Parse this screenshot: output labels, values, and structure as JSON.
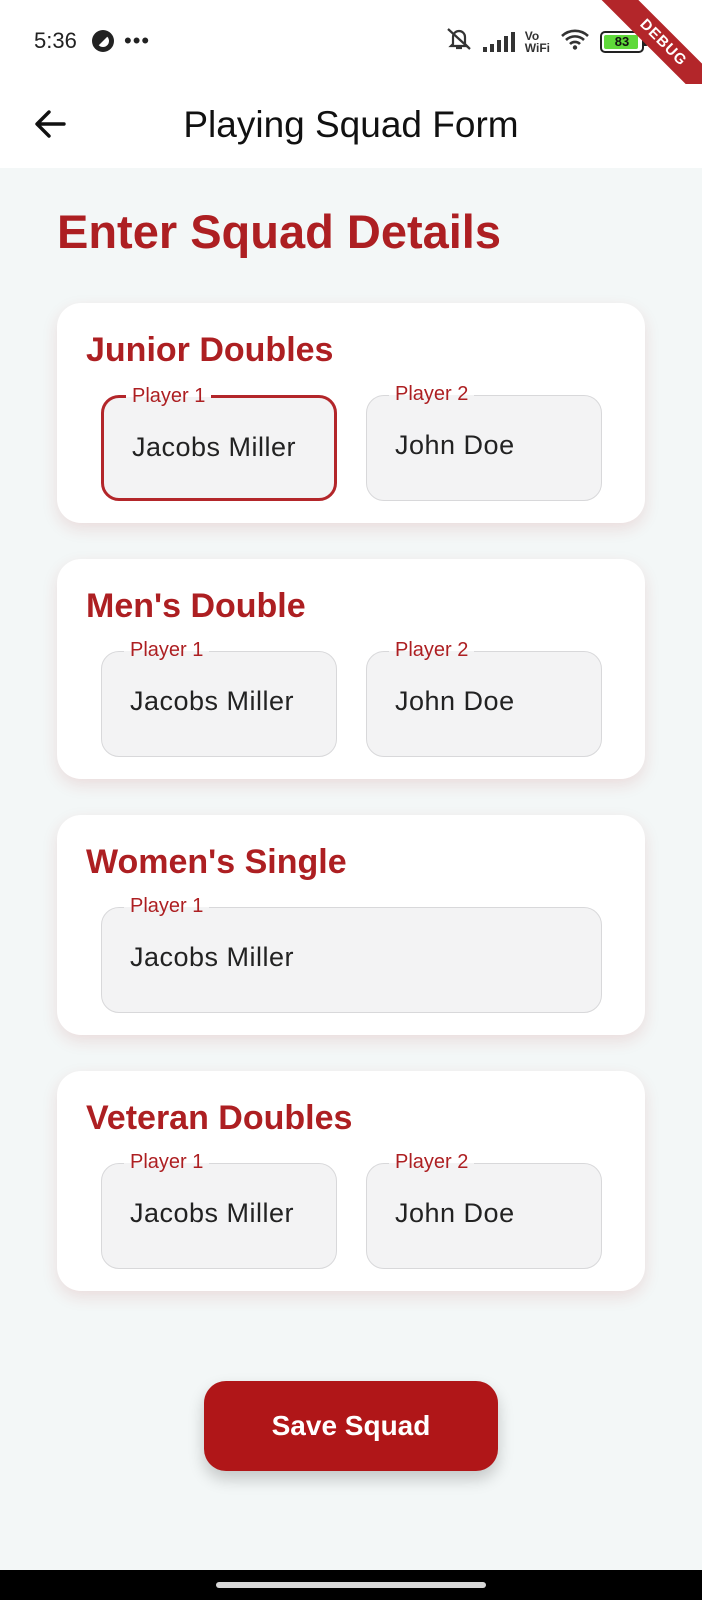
{
  "status_bar": {
    "time": "5:36",
    "left_icons": [
      "circle-status-icon",
      "more-dots-icon"
    ],
    "right_icons": [
      "muted-bell-icon",
      "signal-icon",
      "vowifi-icon",
      "wifi-icon",
      "battery-icon"
    ],
    "vowifi_top": "Vo",
    "vowifi_bottom": "WiFi",
    "battery_level": "83",
    "debug_label": "DEBUG"
  },
  "app_bar": {
    "back_icon": "arrow-left-icon",
    "title": "Playing Squad Form"
  },
  "page_heading": "Enter Squad Details",
  "sections": [
    {
      "title": "Junior Doubles",
      "fields": [
        {
          "label": "Player 1",
          "value": "Jacobs Miller",
          "focused": true
        },
        {
          "label": "Player 2",
          "value": "John Doe"
        }
      ]
    },
    {
      "title": "Men's Double",
      "fields": [
        {
          "label": "Player 1",
          "value": "Jacobs Miller"
        },
        {
          "label": "Player 2",
          "value": "John Doe"
        }
      ]
    },
    {
      "title": "Women's Single",
      "fields": [
        {
          "label": "Player 1",
          "value": "Jacobs Miller"
        }
      ]
    },
    {
      "title": "Veteran Doubles",
      "fields": [
        {
          "label": "Player 1",
          "value": "Jacobs Miller"
        },
        {
          "label": "Player 2",
          "value": "John Doe"
        }
      ]
    }
  ],
  "save_button_label": "Save Squad",
  "colors": {
    "accent": "#ad1f22",
    "button": "#b01618",
    "background": "#f3f7f7",
    "field_background": "#f3f3f4"
  }
}
